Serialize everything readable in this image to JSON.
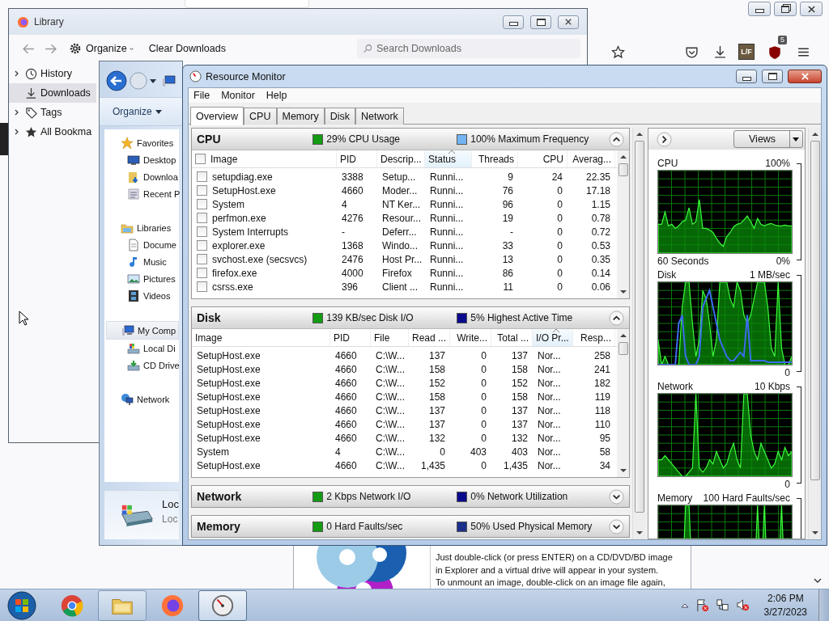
{
  "browser": {
    "addon_label": "L/F",
    "badge": "5"
  },
  "library": {
    "title": "Library",
    "organize": "Organize",
    "clear_downloads": "Clear Downloads",
    "search": {
      "placeholder": "Search Downloads"
    },
    "sidebar": [
      {
        "kind": "history",
        "label": "History",
        "expandable": true,
        "selected": false
      },
      {
        "kind": "downloads",
        "label": "Downloads",
        "expandable": false,
        "selected": true
      },
      {
        "kind": "tags",
        "label": "Tags",
        "expandable": true,
        "selected": false
      },
      {
        "kind": "bookmarks",
        "label": "All Bookma",
        "expandable": true,
        "selected": false
      }
    ]
  },
  "explorer": {
    "organize": "Organize",
    "nav": [
      {
        "label": "Favorites",
        "selected": false,
        "children": [
          {
            "label": "Desktop",
            "selected": false
          },
          {
            "label": "Downloa",
            "selected": false
          },
          {
            "label": "Recent P",
            "selected": false
          }
        ]
      },
      {
        "label": "Libraries",
        "selected": false,
        "children": [
          {
            "label": "Docume",
            "selected": false
          },
          {
            "label": "Music",
            "selected": false
          },
          {
            "label": "Pictures",
            "selected": false
          },
          {
            "label": "Videos",
            "selected": false
          }
        ]
      },
      {
        "label": "My Comp",
        "selected": true,
        "children": [
          {
            "label": "Local Di",
            "selected": false
          },
          {
            "label": "CD Drive",
            "selected": false
          }
        ]
      },
      {
        "label": "Network",
        "selected": false
      }
    ],
    "details": {
      "name": "Loc",
      "type": "Loc"
    }
  },
  "resmon": {
    "title": "Resource Monitor",
    "menu": [
      "File",
      "Monitor",
      "Help"
    ],
    "tabs": [
      {
        "label": "Overview",
        "selected": true
      },
      {
        "label": "CPU",
        "selected": false
      },
      {
        "label": "Memory",
        "selected": false
      },
      {
        "label": "Disk",
        "selected": false
      },
      {
        "label": "Network",
        "selected": false
      }
    ],
    "sections": [
      {
        "name": "CPU",
        "expanded": true,
        "stats": [
          {
            "text": "29% CPU Usage",
            "color": "#139c13"
          },
          {
            "text": "100% Maximum Frequency",
            "color": "#74b4f2"
          }
        ],
        "table": {
          "checkboxes": true,
          "all_checked": false,
          "columns": [
            {
              "label": "Image",
              "numeric": false,
              "sorted": false
            },
            {
              "label": "PID",
              "numeric": false,
              "sorted": false
            },
            {
              "label": "Descrip...",
              "numeric": false,
              "sorted": false
            },
            {
              "label": "Status",
              "numeric": false,
              "sorted": true
            },
            {
              "label": "Threads",
              "numeric": true,
              "sorted": false
            },
            {
              "label": "CPU",
              "numeric": true,
              "sorted": false
            },
            {
              "label": "Averag...",
              "numeric": true,
              "sorted": false
            }
          ],
          "rows": [
            {
              "checked": false,
              "cells": [
                "setupdiag.exe",
                "3388",
                "Setup...",
                "Runni...",
                "9",
                "24",
                "22.35"
              ]
            },
            {
              "checked": false,
              "cells": [
                "SetupHost.exe",
                "4660",
                "Moder...",
                "Runni...",
                "76",
                "0",
                "17.18"
              ]
            },
            {
              "checked": false,
              "cells": [
                "System",
                "4",
                "NT Ker...",
                "Runni...",
                "96",
                "0",
                "1.15"
              ]
            },
            {
              "checked": false,
              "cells": [
                "perfmon.exe",
                "4276",
                "Resour...",
                "Runni...",
                "19",
                "0",
                "0.78"
              ]
            },
            {
              "checked": false,
              "cells": [
                "System Interrupts",
                "-",
                "Deferr...",
                "Runni...",
                "-",
                "0",
                "0.72"
              ]
            },
            {
              "checked": false,
              "cells": [
                "explorer.exe",
                "1368",
                "Windo...",
                "Runni...",
                "33",
                "0",
                "0.53"
              ]
            },
            {
              "checked": false,
              "cells": [
                "svchost.exe (secsvcs)",
                "2476",
                "Host Pr...",
                "Runni...",
                "13",
                "0",
                "0.35"
              ]
            },
            {
              "checked": false,
              "cells": [
                "firefox.exe",
                "4000",
                "Firefox",
                "Runni...",
                "86",
                "0",
                "0.14"
              ]
            },
            {
              "checked": false,
              "cells": [
                "csrss.exe",
                "396",
                "Client ...",
                "Runni...",
                "11",
                "0",
                "0.06"
              ]
            }
          ]
        }
      },
      {
        "name": "Disk",
        "expanded": true,
        "stats": [
          {
            "text": "139 KB/sec Disk I/O",
            "color": "#139c13"
          },
          {
            "text": "5% Highest Active Time",
            "color": "#0a0a8c"
          }
        ],
        "table": {
          "checkboxes": false,
          "columns": [
            {
              "label": "Image",
              "numeric": false,
              "sorted": false
            },
            {
              "label": "PID",
              "numeric": false,
              "sorted": false
            },
            {
              "label": "File",
              "numeric": false,
              "sorted": false
            },
            {
              "label": "Read ...",
              "numeric": true,
              "sorted": false
            },
            {
              "label": "Write...",
              "numeric": true,
              "sorted": false
            },
            {
              "label": "Total ...",
              "numeric": true,
              "sorted": false
            },
            {
              "label": "I/O Pr...",
              "numeric": false,
              "sorted": true
            },
            {
              "label": "Resp...",
              "numeric": true,
              "sorted": false
            }
          ],
          "rows": [
            {
              "cells": [
                "SetupHost.exe",
                "4660",
                "C:\\W...",
                "137",
                "0",
                "137",
                "Nor...",
                "258"
              ]
            },
            {
              "cells": [
                "SetupHost.exe",
                "4660",
                "C:\\W...",
                "158",
                "0",
                "158",
                "Nor...",
                "241"
              ]
            },
            {
              "cells": [
                "SetupHost.exe",
                "4660",
                "C:\\W...",
                "152",
                "0",
                "152",
                "Nor...",
                "182"
              ]
            },
            {
              "cells": [
                "SetupHost.exe",
                "4660",
                "C:\\W...",
                "158",
                "0",
                "158",
                "Nor...",
                "119"
              ]
            },
            {
              "cells": [
                "SetupHost.exe",
                "4660",
                "C:\\W...",
                "137",
                "0",
                "137",
                "Nor...",
                "118"
              ]
            },
            {
              "cells": [
                "SetupHost.exe",
                "4660",
                "C:\\W...",
                "137",
                "0",
                "137",
                "Nor...",
                "110"
              ]
            },
            {
              "cells": [
                "SetupHost.exe",
                "4660",
                "C:\\W...",
                "132",
                "0",
                "132",
                "Nor...",
                "95"
              ]
            },
            {
              "cells": [
                "System",
                "4",
                "C:\\W...",
                "0",
                "403",
                "403",
                "Nor...",
                "58"
              ]
            },
            {
              "cells": [
                "SetupHost.exe",
                "4660",
                "C:\\W...",
                "1,435",
                "0",
                "1,435",
                "Nor...",
                "34"
              ]
            }
          ]
        }
      },
      {
        "name": "Network",
        "expanded": false,
        "stats": [
          {
            "text": "2 Kbps Network I/O",
            "color": "#139c13"
          },
          {
            "text": "0% Network Utilization",
            "color": "#0a0a8c"
          }
        ]
      },
      {
        "name": "Memory",
        "expanded": false,
        "stats": [
          {
            "text": "0 Hard Faults/sec",
            "color": "#139c13"
          },
          {
            "text": "50% Used Physical Memory",
            "color": "#1c2f8a"
          }
        ]
      }
    ],
    "views": "Views",
    "graphs": [
      {
        "kind": "cpu",
        "title": "CPU",
        "max": "100%",
        "footer": "60 Seconds",
        "min": "0%"
      },
      {
        "kind": "disk",
        "title": "Disk",
        "max": "1 MB/sec",
        "min": "0"
      },
      {
        "kind": "network",
        "title": "Network",
        "max": "10 Kbps",
        "min": "0"
      },
      {
        "kind": "memory",
        "title": "Memory",
        "max": "100 Hard Faults/sec"
      }
    ]
  },
  "mount_help": {
    "lines": [
      "Just double-click (or press ENTER) on a CD/DVD/BD image",
      "in Explorer and a virtual drive will appear in your system.",
      "To unmount an image, double-click on an image file again,"
    ]
  },
  "taskbar": {
    "items": [
      {
        "kind": "chrome",
        "running": false,
        "selected": false
      },
      {
        "kind": "explorer",
        "running": true,
        "selected": false
      },
      {
        "kind": "firefox",
        "running": false,
        "selected": false
      },
      {
        "kind": "resmon",
        "running": true,
        "selected": true
      }
    ],
    "time": "2:06 PM",
    "date": "3/27/2023"
  }
}
